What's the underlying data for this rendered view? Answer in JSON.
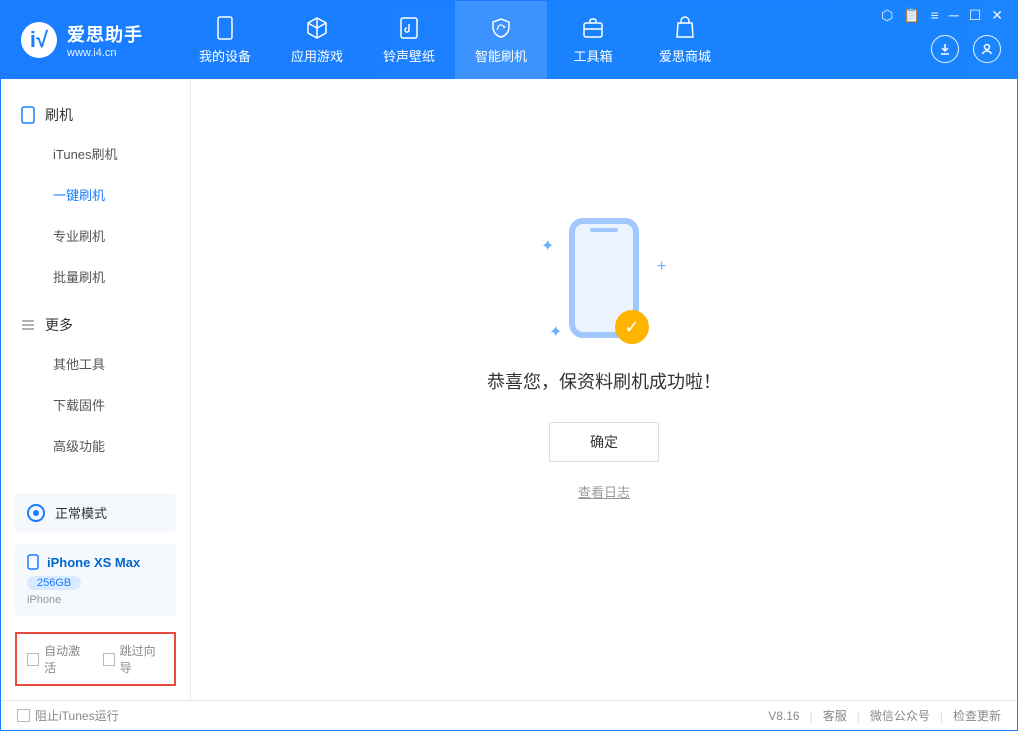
{
  "app": {
    "title": "爱思助手",
    "url": "www.i4.cn"
  },
  "tabs": [
    {
      "label": "我的设备"
    },
    {
      "label": "应用游戏"
    },
    {
      "label": "铃声壁纸"
    },
    {
      "label": "智能刷机"
    },
    {
      "label": "工具箱"
    },
    {
      "label": "爱思商城"
    }
  ],
  "sidebar": {
    "section1": {
      "title": "刷机"
    },
    "items1": [
      {
        "label": "iTunes刷机"
      },
      {
        "label": "一键刷机"
      },
      {
        "label": "专业刷机"
      },
      {
        "label": "批量刷机"
      }
    ],
    "section2": {
      "title": "更多"
    },
    "items2": [
      {
        "label": "其他工具"
      },
      {
        "label": "下载固件"
      },
      {
        "label": "高级功能"
      }
    ]
  },
  "mode": {
    "label": "正常模式"
  },
  "device": {
    "name": "iPhone XS Max",
    "capacity": "256GB",
    "type": "iPhone"
  },
  "options": {
    "opt1": "自动激活",
    "opt2": "跳过向导"
  },
  "main": {
    "success_msg": "恭喜您，保资料刷机成功啦！",
    "confirm": "确定",
    "log_link": "查看日志"
  },
  "footer": {
    "block_itunes": "阻止iTunes运行",
    "version": "V8.16",
    "link1": "客服",
    "link2": "微信公众号",
    "link3": "检查更新"
  }
}
